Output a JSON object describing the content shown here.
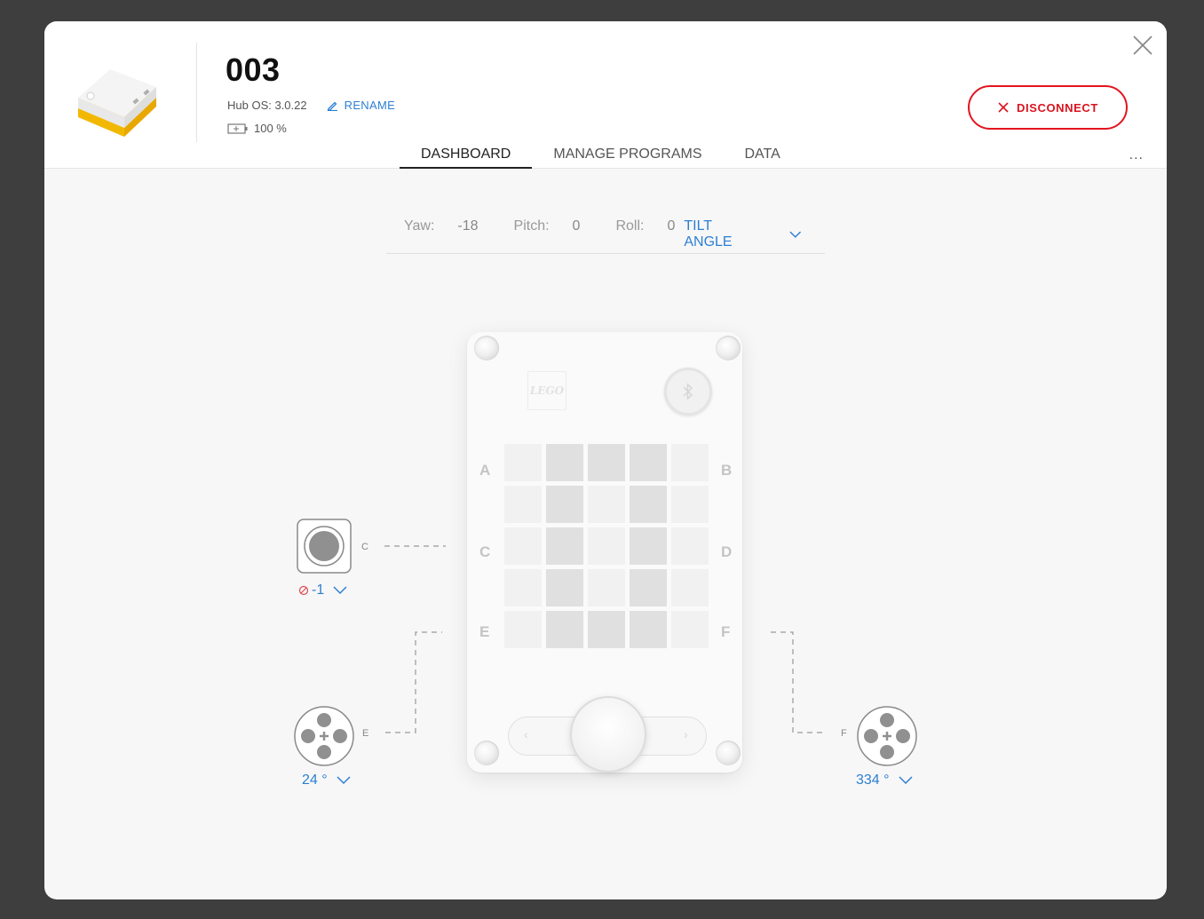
{
  "header": {
    "hub_name": "003",
    "hub_os": "Hub OS: 3.0.22",
    "rename_label": "RENAME",
    "battery": "100 %",
    "disconnect_label": "DISCONNECT",
    "more_label": "..."
  },
  "tabs": [
    {
      "label": "DASHBOARD",
      "active": true
    },
    {
      "label": "MANAGE PROGRAMS",
      "active": false
    },
    {
      "label": "DATA",
      "active": false
    }
  ],
  "tilt": {
    "yaw_label": "Yaw:",
    "yaw_value": "-18",
    "pitch_label": "Pitch:",
    "pitch_value": "0",
    "roll_label": "Roll:",
    "roll_value": "0",
    "mode_label": "TILT ANGLE"
  },
  "hub": {
    "logo_text": "LEGO",
    "ports": [
      "A",
      "B",
      "C",
      "D",
      "E",
      "F"
    ],
    "matrix": [
      [
        0,
        1,
        1,
        1,
        0
      ],
      [
        0,
        1,
        0,
        1,
        0
      ],
      [
        0,
        1,
        0,
        1,
        0
      ],
      [
        0,
        1,
        0,
        1,
        0
      ],
      [
        0,
        1,
        1,
        1,
        0
      ]
    ],
    "left_arrow": "‹",
    "right_arrow": "›"
  },
  "devices": {
    "sensor_c": {
      "port": "C",
      "value": "-1"
    },
    "motor_e": {
      "port": "E",
      "value": "24 °"
    },
    "motor_f": {
      "port": "F",
      "value": "334 °"
    }
  },
  "colors": {
    "accent": "#2d7fd3",
    "danger": "#e3141e",
    "backdrop": "#3e3e3e"
  }
}
